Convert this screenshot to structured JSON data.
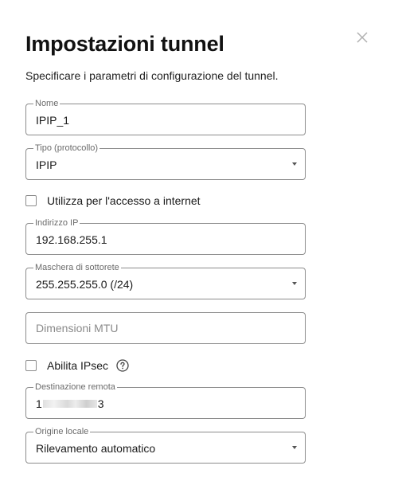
{
  "dialog": {
    "title": "Impostazioni tunnel",
    "subtitle": "Specificare i parametri di configurazione del tunnel.",
    "close_icon": "close-icon"
  },
  "fields": {
    "name": {
      "label": "Nome",
      "value": "IPIP_1"
    },
    "type": {
      "label": "Tipo (protocollo)",
      "value": "IPIP"
    },
    "internet": {
      "label": "Utilizza per l'accesso a internet",
      "checked": false
    },
    "ip": {
      "label": "Indirizzo IP",
      "value": "192.168.255.1"
    },
    "mask": {
      "label": "Maschera di sottorete",
      "value": "255.255.255.0 (/24)"
    },
    "mtu": {
      "placeholder": "Dimensioni MTU",
      "value": ""
    },
    "ipsec": {
      "label": "Abilita IPsec",
      "checked": false,
      "help_icon": "help-circle-icon"
    },
    "remote": {
      "label": "Destinazione remota",
      "value_prefix": "1",
      "value_suffix": "3"
    },
    "origin": {
      "label": "Origine locale",
      "value": "Rilevamento automatico"
    }
  }
}
